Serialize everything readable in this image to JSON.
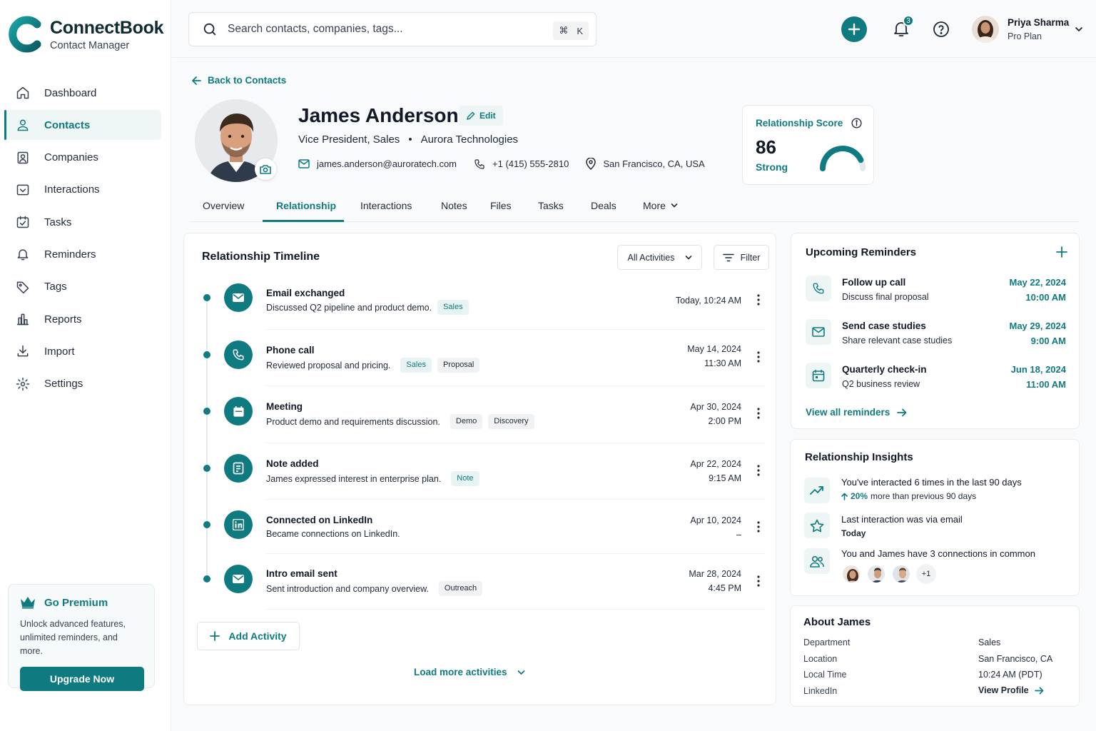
{
  "brand": {
    "name": "ConnectBook",
    "subtitle": "Contact Manager"
  },
  "nav": [
    {
      "label": "Dashboard",
      "icon": "home-icon"
    },
    {
      "label": "Contacts",
      "icon": "user-icon",
      "active": true
    },
    {
      "label": "Companies",
      "icon": "building-icon"
    },
    {
      "label": "Interactions",
      "icon": "inbox-icon"
    },
    {
      "label": "Tasks",
      "icon": "checklist-icon"
    },
    {
      "label": "Reminders",
      "icon": "bell-icon"
    },
    {
      "label": "Tags",
      "icon": "tag-icon"
    },
    {
      "label": "Reports",
      "icon": "bar-chart-icon"
    },
    {
      "label": "Import",
      "icon": "download-icon"
    },
    {
      "label": "Settings",
      "icon": "gear-icon"
    }
  ],
  "premium": {
    "title": "Go Premium",
    "text_line1": "Unlock advanced features,",
    "text_line2": "unlimited reminders, and more.",
    "button": "Upgrade Now"
  },
  "search": {
    "placeholder": "Search contacts, companies, tags...",
    "shortcut_mod": "⌘",
    "shortcut_key": "K"
  },
  "header": {
    "notification_count": "3",
    "user_name": "Priya Sharma",
    "user_plan": "Pro Plan"
  },
  "profile": {
    "back_label": "Back to Contacts",
    "name": "James Anderson",
    "edit_label": "Edit",
    "title": "Vice President, Sales",
    "separator": "•",
    "company": "Aurora Technologies",
    "email": "james.anderson@auroratech.com",
    "phone": "+1 (415) 555-2810",
    "location": "San Francisco, CA, USA"
  },
  "score": {
    "label": "Relationship Score",
    "value": "86",
    "level": "Strong",
    "fraction": 0.86
  },
  "tabs": [
    "Overview",
    "Relationship",
    "Interactions",
    "Notes",
    "Files",
    "Tasks",
    "Deals",
    "More"
  ],
  "active_tab": "Relationship",
  "timeline": {
    "title": "Relationship Timeline",
    "filter_select": "All Activities",
    "filter_button": "Filter",
    "items": [
      {
        "title": "Email exchanged",
        "desc": "Discussed Q2 pipeline and product demo.",
        "tags": [
          "Sales"
        ],
        "date": "Today, 10:24 AM",
        "time": "",
        "icon": "mail-icon"
      },
      {
        "title": "Phone call",
        "desc": "Reviewed proposal and pricing.",
        "tags": [
          "Sales",
          "Proposal"
        ],
        "date": "May 14, 2024",
        "time": "11:30 AM",
        "icon": "phone-icon"
      },
      {
        "title": "Meeting",
        "desc": "Product demo and requirements discussion.",
        "tags": [
          "Demo",
          "Discovery"
        ],
        "date": "Apr 30, 2024",
        "time": "2:00 PM",
        "icon": "calendar-icon"
      },
      {
        "title": "Note added",
        "desc": "James expressed interest in enterprise plan.",
        "tags": [
          "Note"
        ],
        "date": "Apr 22, 2024",
        "time": "9:15 AM",
        "icon": "note-icon"
      },
      {
        "title": "Connected on LinkedIn",
        "desc": "Became connections on LinkedIn.",
        "tags": [],
        "date": "Apr 10, 2024",
        "time": "–",
        "icon": "linkedin-icon"
      },
      {
        "title": "Intro email sent",
        "desc": "Sent introduction and company overview.",
        "tags": [
          "Outreach"
        ],
        "date": "Mar 28, 2024",
        "time": "4:45 PM",
        "icon": "mail-icon"
      }
    ],
    "add_label": "Add Activity",
    "load_more": "Load more activities"
  },
  "reminders": {
    "title": "Upcoming Reminders",
    "items": [
      {
        "title": "Follow up call",
        "sub": "Discuss final proposal",
        "date": "May 22, 2024",
        "time": "10:00 AM",
        "icon": "phone-icon"
      },
      {
        "title": "Send case studies",
        "sub": "Share relevant case studies",
        "date": "May 29, 2024",
        "time": "9:00 AM",
        "icon": "mail-icon"
      },
      {
        "title": "Quarterly check-in",
        "sub": "Q2 business review",
        "date": "Jun 18, 2024",
        "time": "11:00 AM",
        "icon": "calendar-icon"
      }
    ],
    "view_all": "View all reminders"
  },
  "insights": {
    "title": "Relationship Insights",
    "items": [
      {
        "text": "You've interacted 6 times in the last 90 days",
        "highlight": "20%",
        "sub": "more than previous 90 days",
        "icon": "trend-up-icon"
      },
      {
        "text": "Last interaction was via email",
        "sub": "Today",
        "icon": "star-icon"
      },
      {
        "text": "You and James have 3 connections in common",
        "more": "+1",
        "icon": "users-icon"
      }
    ]
  },
  "about": {
    "title": "About James",
    "rows": [
      {
        "label": "Department",
        "value": "Sales"
      },
      {
        "label": "Location",
        "value": "San Francisco, CA"
      },
      {
        "label": "Local Time",
        "value": "10:24 AM (PDT)"
      },
      {
        "label": "LinkedIn",
        "value": "View Profile"
      }
    ]
  },
  "colors": {
    "accent": "#0f7b80",
    "accent_light": "#edf5f5",
    "text": "#1f2937"
  }
}
